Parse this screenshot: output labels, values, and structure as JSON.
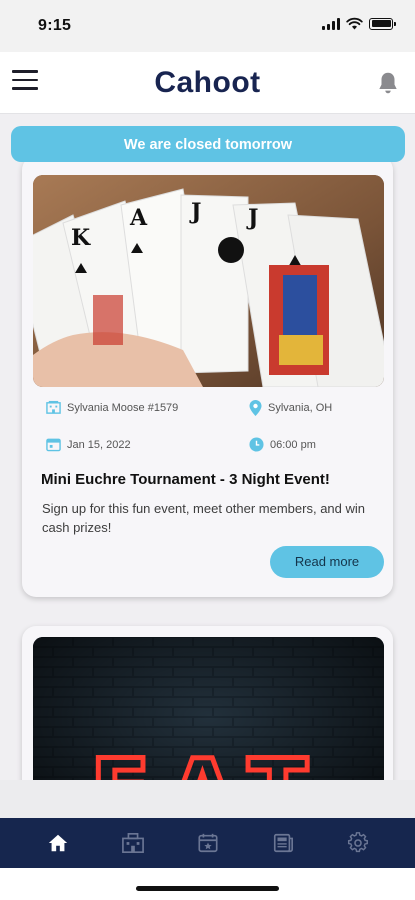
{
  "status_bar": {
    "time": "9:15"
  },
  "header": {
    "app_name": "Cahoot"
  },
  "banner": {
    "text": "We are closed tomorrow"
  },
  "events": [
    {
      "venue": "Sylvania Moose #1579",
      "location": "Sylvania, OH",
      "date": "Jan 15, 2022",
      "time": "06:00 pm",
      "title": "Mini Euchre Tournament - 3 Night Event!",
      "description": "Sign up for this fun event, meet other members, and win cash prizes!",
      "cta_label": "Read more"
    },
    {
      "image_text": "EAT"
    }
  ],
  "tabbar": {
    "items": [
      "home-icon",
      "building-icon",
      "calendar-icon",
      "newspaper-icon",
      "gear-icon"
    ],
    "active": "home-icon",
    "accent_color": "#5fc3e4",
    "bar_color": "#16264e"
  }
}
